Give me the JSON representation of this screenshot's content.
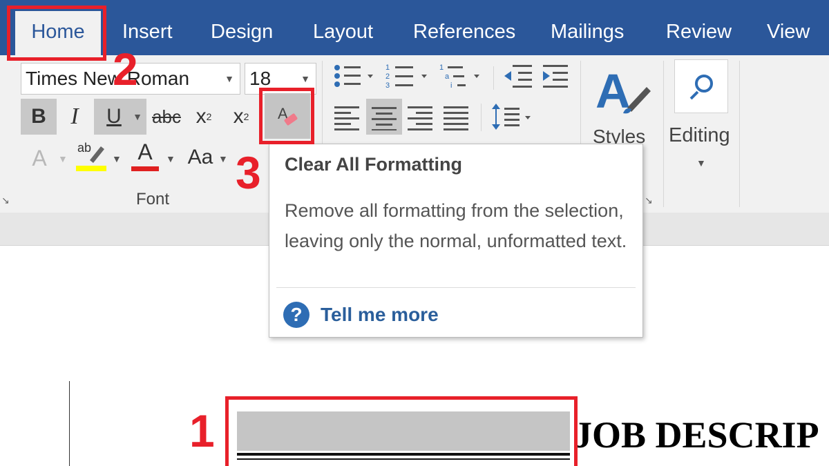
{
  "tabs": [
    {
      "label": "Home",
      "active": true
    },
    {
      "label": "Insert"
    },
    {
      "label": "Design"
    },
    {
      "label": "Layout"
    },
    {
      "label": "References"
    },
    {
      "label": "Mailings"
    },
    {
      "label": "Review"
    },
    {
      "label": "View"
    }
  ],
  "font": {
    "name": "Times New Roman",
    "size": "18",
    "bold": "B",
    "italic": "I",
    "underline": "U",
    "strikethrough": "abc",
    "subscript": "x",
    "subscript_mark": "2",
    "superscript": "x",
    "superscript_mark": "2",
    "text_effects": "A",
    "highlight": "ab",
    "font_color": "A",
    "change_case": "Aa",
    "group_label": "Font"
  },
  "styles": {
    "label": "Styles"
  },
  "editing": {
    "label": "Editing"
  },
  "tooltip": {
    "title": "Clear All Formatting",
    "body": "Remove all formatting from the selection, leaving only the normal, unformatted text.",
    "link": "Tell me more",
    "help_glyph": "?"
  },
  "document": {
    "heading": "JOB DESCRIP"
  },
  "steps": {
    "one": "1",
    "two": "2",
    "three": "3"
  },
  "colors": {
    "ribbon_blue": "#2b579a",
    "annotation_red": "#e8202a",
    "highlight_yellow": "#ffff00",
    "font_red": "#e02020"
  }
}
